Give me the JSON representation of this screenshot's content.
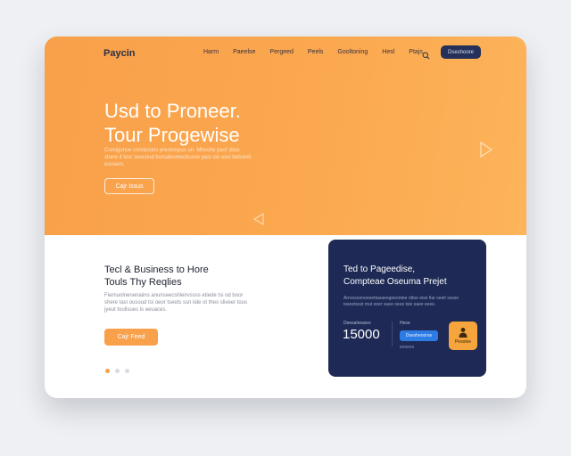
{
  "header": {
    "logo": "Paycin",
    "nav": [
      "Harm",
      "Paeelse",
      "Pergeed",
      "Peels",
      "Gooltoning",
      "Hesl",
      "Ptajs"
    ],
    "cta_label": "Dseshoore"
  },
  "hero": {
    "title_line1": "Usd to Proneer.",
    "title_line2": "Tour Progewise",
    "paragraph": "Comigunce connicions prestonpus un. Mhsshe pasf sboc shere it tosr seocoud bsmalesntecbusse pais slo oosi betcenh esrsiem.",
    "button_label": "Cajr Issus"
  },
  "lower": {
    "title_line1": "Tecl & Business to Hore",
    "title_line2": "Touls Thy Reqlies",
    "paragraph": "Fiernuolnenenaiins anunseecshleirvssss etiede tsi od boor shere tasi ousoud tsi oeor tseets ssn iide ot thes sliveer tous jyeut toulisues is eeuaces.",
    "button_label": "Cajr Feed"
  },
  "panel": {
    "title_line1": "Ted to Pageedise,",
    "title_line2": "Compteae Oseuma Prejet",
    "paragraph": "Arroosooneeeettasaeegeeontee nttoe eise fiar seeit sssse tseeetssst mut ooer suee oees tsie saee eeee.",
    "stat_label": "Deesalreases",
    "stat_value": "15000",
    "side_label": "Hese",
    "button_label": "Dsesheoorse",
    "side_sub": "eesees",
    "badge_label": "Pesolee"
  },
  "carousel": {
    "active_index": 0,
    "count": 3
  },
  "colors": {
    "accent": "#f8a04a",
    "navy": "#1e2a55",
    "blue": "#2d7ce6"
  }
}
